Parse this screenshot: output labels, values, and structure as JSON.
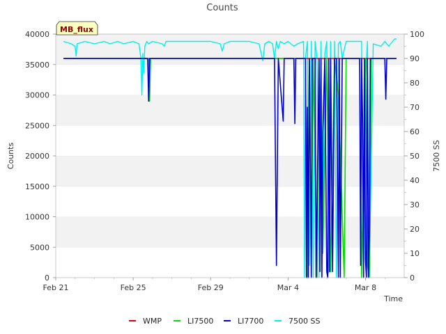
{
  "chart_data": {
    "type": "line",
    "title": "Counts",
    "xlabel": "Time",
    "ylabel": "Counts",
    "y2label": "7500 SS",
    "badge": "MB_flux",
    "x_ticks": [
      "Feb 21",
      "Feb 25",
      "Feb 29",
      "Mar 4",
      "Mar 8"
    ],
    "x_tick_days": [
      0,
      4,
      8,
      12,
      16
    ],
    "x_range_days": [
      0,
      18
    ],
    "ylim": [
      0,
      40000
    ],
    "y_ticks": [
      0,
      5000,
      10000,
      15000,
      20000,
      25000,
      30000,
      35000,
      40000
    ],
    "y2lim": [
      0,
      100
    ],
    "y2_ticks": [
      0,
      10,
      20,
      30,
      40,
      50,
      60,
      70,
      80,
      90,
      100
    ],
    "grid": "horizontal bands",
    "legend_position": "bottom",
    "series": [
      {
        "name": "WMP",
        "color": "#dd0000",
        "axis": "left",
        "x": [
          0.4,
          17.6
        ],
        "y": [
          36000,
          36000
        ]
      },
      {
        "name": "LI7500",
        "color": "#00dd00",
        "axis": "left",
        "x": [
          0.4,
          4.8,
          4.85,
          4.9,
          5.0,
          12.9,
          13.0,
          13.1,
          13.2,
          13.3,
          13.5,
          13.6,
          13.8,
          14.0,
          14.2,
          14.4,
          14.5,
          14.6,
          14.9,
          15.0,
          15.2,
          15.5,
          15.7,
          15.8,
          16.0,
          16.1,
          16.2,
          16.3,
          16.5,
          17.6
        ],
        "y": [
          36000,
          36000,
          29000,
          36000,
          36000,
          36000,
          0,
          36000,
          2000,
          36000,
          0,
          36000,
          4000,
          36000,
          1000,
          36000,
          33000,
          30000,
          0,
          36000,
          36000,
          36000,
          36000,
          0,
          36000,
          2000,
          0,
          36000,
          36000,
          36000
        ]
      },
      {
        "name": "LI7700",
        "color": "#0000cc",
        "axis": "left",
        "x": [
          0.4,
          4.75,
          4.8,
          4.85,
          11.3,
          11.4,
          11.5,
          11.75,
          11.8,
          12.3,
          12.35,
          12.4,
          12.9,
          12.95,
          13.0,
          13.05,
          13.1,
          13.2,
          13.25,
          13.4,
          13.45,
          13.6,
          13.65,
          13.7,
          13.75,
          13.8,
          13.9,
          14.0,
          14.05,
          14.1,
          14.15,
          14.2,
          14.3,
          14.4,
          14.5,
          14.6,
          14.65,
          14.7,
          14.8,
          14.9,
          15.0,
          15.7,
          15.75,
          15.8,
          15.85,
          15.9,
          15.95,
          16.0,
          16.05,
          16.1,
          16.15,
          16.2,
          16.25,
          17.0,
          17.05,
          17.1,
          17.6
        ],
        "y": [
          36000,
          36000,
          29000,
          36000,
          36000,
          2000,
          36000,
          25700,
          36000,
          36000,
          25300,
          36000,
          36000,
          0,
          28000,
          0,
          36000,
          0,
          36000,
          36000,
          0,
          36000,
          1000,
          36000,
          0,
          24000,
          36000,
          1000,
          0,
          36000,
          1000,
          36000,
          1000,
          36000,
          36000,
          0,
          36000,
          0,
          36000,
          36000,
          36000,
          36000,
          2000,
          36000,
          25600,
          0,
          36000,
          3000,
          0,
          36000,
          0,
          7000,
          36000,
          36000,
          29300,
          36000,
          36000
        ]
      },
      {
        "name": "7500 SS",
        "color": "#00eeee",
        "axis": "right",
        "x": [
          0.4,
          0.8,
          1.0,
          1.05,
          1.1,
          1.5,
          2.0,
          2.5,
          2.8,
          3.2,
          3.5,
          4.0,
          4.3,
          4.4,
          4.45,
          4.5,
          4.55,
          4.6,
          4.7,
          4.8,
          5.0,
          5.5,
          5.6,
          5.7,
          6.0,
          6.5,
          7.0,
          7.5,
          8.0,
          8.5,
          8.6,
          8.7,
          9.0,
          9.5,
          10.0,
          10.5,
          10.7,
          10.8,
          11.0,
          11.2,
          11.3,
          11.4,
          11.5,
          11.6,
          11.8,
          12.0,
          12.3,
          12.5,
          12.8,
          12.85,
          12.9,
          13.0,
          13.1,
          13.2,
          13.3,
          13.4,
          13.5,
          13.6,
          13.7,
          13.8,
          13.9,
          14.0,
          14.1,
          14.2,
          14.3,
          14.4,
          14.5,
          14.6,
          14.7,
          14.8,
          15.0,
          15.5,
          15.8,
          15.9,
          16.0,
          16.1,
          16.2,
          16.4,
          16.8,
          17.0,
          17.2,
          17.5,
          17.6
        ],
        "y": [
          97,
          96,
          95,
          91,
          96,
          97,
          96,
          97,
          96,
          97,
          96,
          97,
          96,
          90,
          75,
          92,
          84,
          95,
          97,
          96,
          97,
          96,
          95,
          97,
          97,
          97,
          97,
          97,
          97,
          96,
          93,
          96,
          97,
          97,
          97,
          96,
          89,
          96,
          97,
          96,
          90,
          97,
          94,
          97,
          96,
          97,
          95,
          96,
          97,
          0,
          90,
          97,
          5,
          97,
          0,
          97,
          90,
          0,
          97,
          10,
          92,
          97,
          2,
          97,
          4,
          97,
          0,
          96,
          97,
          90,
          97,
          97,
          97,
          0,
          80,
          97,
          0,
          96,
          95,
          97,
          95,
          98,
          98
        ]
      }
    ]
  }
}
